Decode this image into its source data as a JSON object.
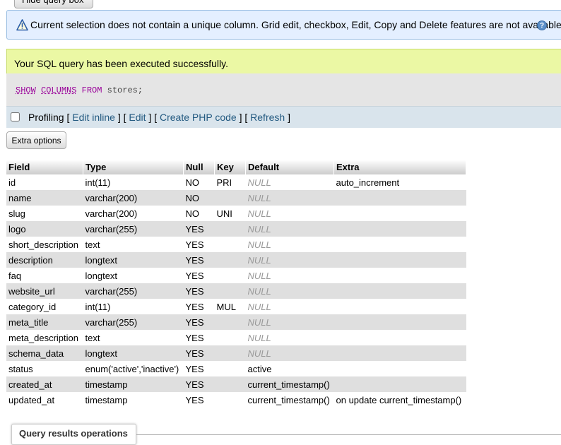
{
  "top_button": "Hide query box",
  "notice": {
    "text": "Current selection does not contain a unique column. Grid edit, checkbox, Edit, Copy and Delete features are not available.",
    "help": "?"
  },
  "success": {
    "text": "Your SQL query has been executed successfully."
  },
  "sql": {
    "kw1": "SHOW",
    "kw2": "COLUMNS",
    "kw3": "FROM",
    "rest": " stores;"
  },
  "toolbar": {
    "profiling": "Profiling",
    "edit_inline": "Edit inline",
    "edit": "Edit",
    "create_php": "Create PHP code",
    "refresh": "Refresh"
  },
  "extra_options": "Extra options",
  "columns_table": {
    "headers": [
      "Field",
      "Type",
      "Null",
      "Key",
      "Default",
      "Extra"
    ],
    "rows": [
      [
        "id",
        "int(11)",
        "NO",
        "PRI",
        "NULL",
        "auto_increment"
      ],
      [
        "name",
        "varchar(200)",
        "NO",
        "",
        "NULL",
        ""
      ],
      [
        "slug",
        "varchar(200)",
        "NO",
        "UNI",
        "NULL",
        ""
      ],
      [
        "logo",
        "varchar(255)",
        "YES",
        "",
        "NULL",
        ""
      ],
      [
        "short_description",
        "text",
        "YES",
        "",
        "NULL",
        ""
      ],
      [
        "description",
        "longtext",
        "YES",
        "",
        "NULL",
        ""
      ],
      [
        "faq",
        "longtext",
        "YES",
        "",
        "NULL",
        ""
      ],
      [
        "website_url",
        "varchar(255)",
        "YES",
        "",
        "NULL",
        ""
      ],
      [
        "category_id",
        "int(11)",
        "YES",
        "MUL",
        "NULL",
        ""
      ],
      [
        "meta_title",
        "varchar(255)",
        "YES",
        "",
        "NULL",
        ""
      ],
      [
        "meta_description",
        "text",
        "YES",
        "",
        "NULL",
        ""
      ],
      [
        "schema_data",
        "longtext",
        "YES",
        "",
        "NULL",
        ""
      ],
      [
        "status",
        "enum('active','inactive')",
        "YES",
        "",
        "active",
        ""
      ],
      [
        "created_at",
        "timestamp",
        "YES",
        "",
        "current_timestamp()",
        ""
      ],
      [
        "updated_at",
        "timestamp",
        "YES",
        "",
        "current_timestamp()",
        "on update current_timestamp()"
      ]
    ]
  },
  "query_results_operations": "Query results operations",
  "colors": {
    "notice_bg": "#e4efff",
    "success_bg": "#ebf8a4",
    "link": "#235a81",
    "keyword": "#990099"
  }
}
